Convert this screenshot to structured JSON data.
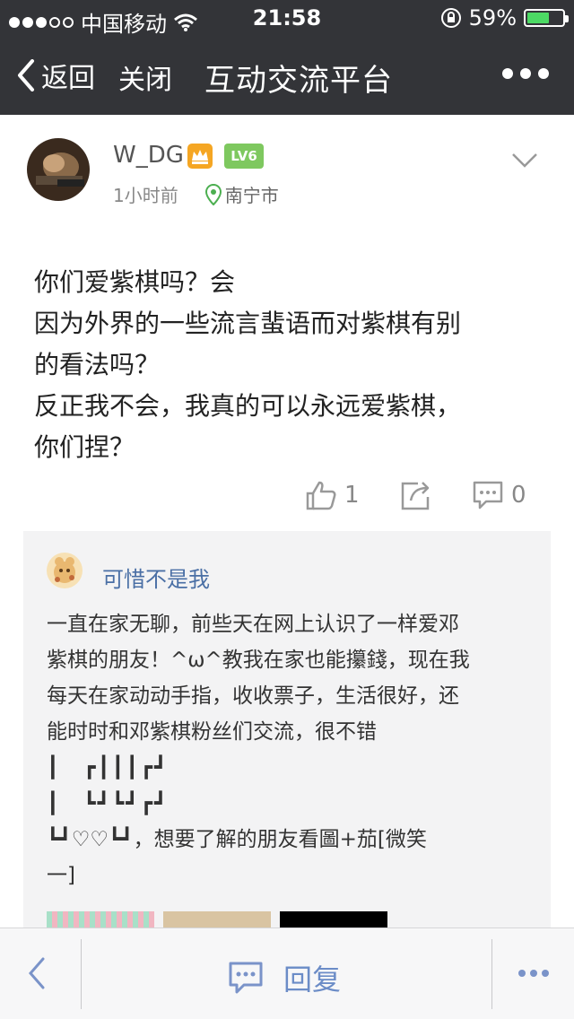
{
  "status_bar": {
    "carrier": "中国移动",
    "time": "21:58",
    "battery": "59%",
    "battery_level": 0.59
  },
  "nav": {
    "back_label": "返回",
    "close_label": "关闭",
    "title": "互动交流平台"
  },
  "post": {
    "username": "W_DG",
    "level": "LV6",
    "time_ago": "1小时前",
    "location": "南宁市",
    "lines": [
      "你们爱紫棋吗？会",
      "因为外界的一些流言蜚语而对紫棋有别",
      "的看法吗？",
      "反正我不会，我真的可以永远爱紫棋，",
      "你们捏？"
    ],
    "likes": "1",
    "comments": "0"
  },
  "comment": {
    "author": "可惜不是我",
    "lines": [
      "一直在家无聊，前些天在网上认识了一样爱邓",
      "紫棋的朋友！^ω^教我在家也能攥錢，现在我",
      "每天在家动动手指，收收票子，生活很好，还",
      "能时时和邓紫棋粉丝们交流，很不错",
      "┃　┏┃┃┃┏┛",
      "┃　┗┛┗┛┏┛",
      "┗┛♡♡┗┛，想要了解的朋友看圖+茄[微笑",
      "一]"
    ]
  },
  "bottom_bar": {
    "reply_label": "回复"
  },
  "colors": {
    "nav_bg": "#333438",
    "level_badge": "#7ec85f",
    "crown_badge": "#f5a623",
    "link_blue": "#4a6fa5",
    "location_green": "#4caf50",
    "comment_bg": "#f3f3f4"
  },
  "icons": [
    "signal-icon",
    "wifi-icon",
    "orientation-lock-icon",
    "battery-icon",
    "back-chevron-icon",
    "more-dots-icon",
    "crown-icon",
    "location-pin-icon",
    "chevron-down-icon",
    "thumbs-up-icon",
    "share-icon",
    "comment-icon"
  ]
}
